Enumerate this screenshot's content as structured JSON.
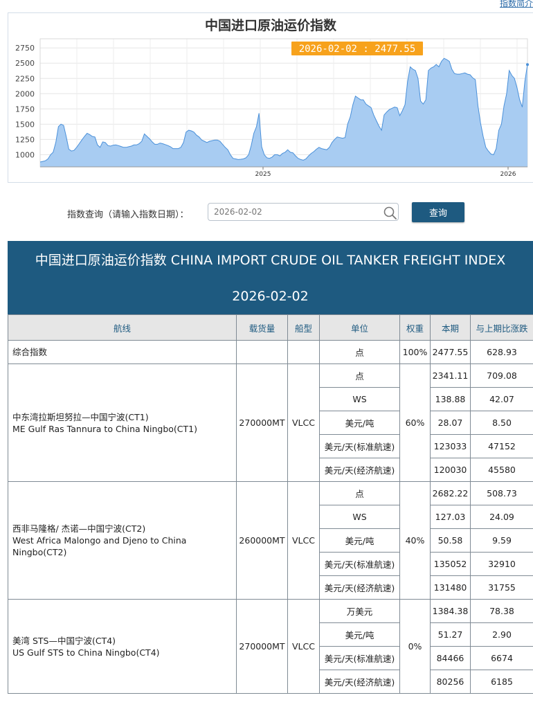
{
  "top_link": "指数简介",
  "chart": {
    "title": "中国进口原油运价指数",
    "tooltip": "2026-02-02 : 2477.55",
    "fill_color": "#a8ccf2",
    "line_color": "#4a90d9",
    "tooltip_bg": "#f7a21c"
  },
  "chart_data": {
    "type": "area",
    "title": "中国进口原油运价指数",
    "ylim": [
      800,
      2900
    ],
    "yticks": [
      1000,
      1250,
      1500,
      1750,
      2000,
      2250,
      2500,
      2750
    ],
    "xtick_labels": [
      "2025",
      "2026"
    ],
    "grid": true,
    "values": [
      880,
      890,
      900,
      930,
      1000,
      1040,
      1200,
      1460,
      1500,
      1480,
      1300,
      1090,
      1060,
      1070,
      1120,
      1180,
      1240,
      1300,
      1350,
      1330,
      1300,
      1290,
      1160,
      1120,
      1210,
      1200,
      1150,
      1140,
      1155,
      1160,
      1150,
      1135,
      1120,
      1120,
      1130,
      1140,
      1160,
      1160,
      1180,
      1220,
      1340,
      1300,
      1260,
      1210,
      1170,
      1170,
      1190,
      1180,
      1165,
      1150,
      1130,
      1100,
      1100,
      1100,
      1120,
      1200,
      1370,
      1400,
      1390,
      1370,
      1320,
      1290,
      1240,
      1220,
      1200,
      1220,
      1230,
      1240,
      1240,
      1220,
      1170,
      1120,
      1080,
      1000,
      940,
      930,
      920,
      925,
      930,
      950,
      1000,
      1150,
      1350,
      1460,
      1680,
      1130,
      1000,
      950,
      940,
      960,
      1000,
      1000,
      980,
      1020,
      1040,
      1080,
      1040,
      1030,
      980,
      940,
      920,
      910,
      930,
      980,
      1020,
      1050,
      1090,
      1120,
      1100,
      1090,
      1080,
      1120,
      1200,
      1250,
      1290,
      1280,
      1270,
      1280,
      1500,
      1620,
      1820,
      1960,
      1930,
      1900,
      1900,
      1830,
      1800,
      1770,
      1650,
      1560,
      1470,
      1400,
      1650,
      1700,
      1740,
      1760,
      1780,
      1770,
      1640,
      1720,
      1820,
      2200,
      2440,
      2400,
      2380,
      2250,
      1880,
      1830,
      1900,
      2380,
      2420,
      2440,
      2480,
      2440,
      2530,
      2580,
      2560,
      2530,
      2400,
      2330,
      2320,
      2320,
      2330,
      2340,
      2320,
      2310,
      2260,
      2230,
      1800,
      1520,
      1300,
      1120,
      1060,
      1010,
      1000,
      1100,
      1400,
      1500,
      1800,
      2000,
      2380,
      2300,
      2250,
      2100,
      1900,
      1780,
      2200,
      2477.55
    ]
  },
  "query": {
    "label": "指数查询（请输入指数日期）：",
    "placeholder": "2026-02-02",
    "button": "查询"
  },
  "table": {
    "title": "中国进口原油运价指数 CHINA IMPORT CRUDE OIL TANKER FREIGHT INDEX",
    "date": "2026-02-02",
    "headers": {
      "route": "航线",
      "cargo": "载货量",
      "ship": "船型",
      "unit": "单位",
      "weight": "权重",
      "current": "本期",
      "change": "与上期比涨跌"
    },
    "composite": {
      "route": "综合指数",
      "unit": "点",
      "weight": "100%",
      "current": "2477.55",
      "change": "628.93"
    },
    "routes": [
      {
        "name_cn": "中东湾拉斯坦努拉—中国宁波(CT1)",
        "name_en": "ME Gulf Ras Tannura to China Ningbo(CT1)",
        "cargo": "270000MT",
        "ship": "VLCC",
        "weight": "60%",
        "rows": [
          {
            "unit": "点",
            "current": "2341.11",
            "change": "709.08"
          },
          {
            "unit": "WS",
            "current": "138.88",
            "change": "42.07"
          },
          {
            "unit": "美元/吨",
            "current": "28.07",
            "change": "8.50"
          },
          {
            "unit": "美元/天(标准航速)",
            "current": "123033",
            "change": "47152"
          },
          {
            "unit": "美元/天(经济航速)",
            "current": "120030",
            "change": "45580"
          }
        ]
      },
      {
        "name_cn": "西非马隆格/ 杰诺—中国宁波(CT2)",
        "name_en": "West Africa Malongo and Djeno to China Ningbo(CT2)",
        "cargo": "260000MT",
        "ship": "VLCC",
        "weight": "40%",
        "rows": [
          {
            "unit": "点",
            "current": "2682.22",
            "change": "508.73"
          },
          {
            "unit": "WS",
            "current": "127.03",
            "change": "24.09"
          },
          {
            "unit": "美元/吨",
            "current": "50.58",
            "change": "9.59"
          },
          {
            "unit": "美元/天(标准航速)",
            "current": "135052",
            "change": "32910"
          },
          {
            "unit": "美元/天(经济航速)",
            "current": "131480",
            "change": "31755"
          }
        ]
      },
      {
        "name_cn": "美湾 STS—中国宁波(CT4)",
        "name_en": "US Gulf STS to China Ningbo(CT4)",
        "cargo": "270000MT",
        "ship": "VLCC",
        "weight": "0%",
        "rows": [
          {
            "unit": "万美元",
            "current": "1384.38",
            "change": "78.38"
          },
          {
            "unit": "美元/吨",
            "current": "51.27",
            "change": "2.90"
          },
          {
            "unit": "美元/天(标准航速)",
            "current": "84466",
            "change": "6674"
          },
          {
            "unit": "美元/天(经济航速)",
            "current": "80256",
            "change": "6185"
          }
        ]
      }
    ]
  }
}
